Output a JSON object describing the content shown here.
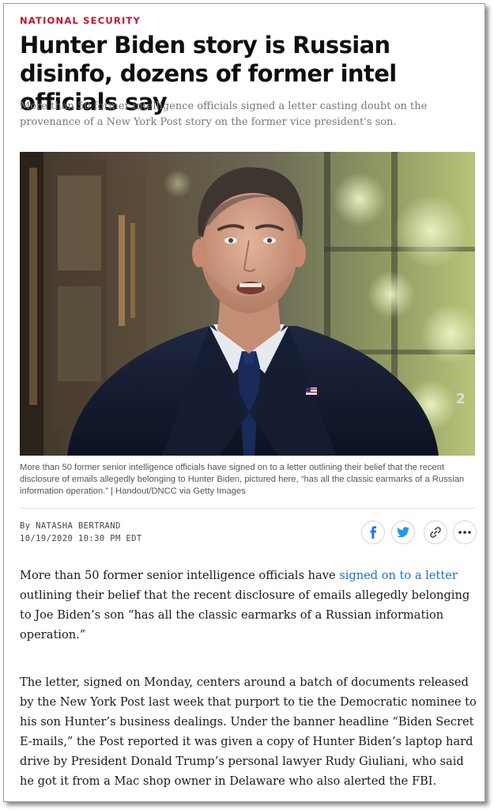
{
  "article": {
    "kicker": "NATIONAL SECURITY",
    "headline": "Hunter Biden story is Russian disinfo, dozens of former intel officials say",
    "dek": "More than 50 former intelligence officials signed a letter casting doubt on the provenance of a New York Post story on the former vice president's son.",
    "image": {
      "watermark": "2"
    },
    "caption": "More than 50 former senior intelligence officials have signed on to a letter outlining their belief that the recent disclosure of emails allegedly belonging to Hunter Biden, pictured here, “has all the classic earmarks of a Russian information operation.” | Handout/DNCC via Getty Images",
    "byline": {
      "prefix": "By ",
      "author": "NATASHA BERTRAND",
      "timestamp": "10/19/2020 10:30 PM EDT"
    },
    "share": {
      "icons": [
        "facebook-icon",
        "twitter-icon",
        "link-icon",
        "more-icon"
      ],
      "colors": {
        "facebook": "#1877f2",
        "twitter": "#1da1f2",
        "neutral": "#333333"
      }
    },
    "paragraph1": {
      "before": "More than 50 former senior intelligence officials have ",
      "link": "signed on to a letter",
      "after": " outlining their belief that the recent disclosure of emails allegedly belonging to Joe Biden’s son “has all the classic earmarks of a Russian information operation.”"
    },
    "paragraph2": "The letter, signed on Monday, centers around a batch of documents released by the New York Post last week that purport to tie the Democratic nominee to his son Hunter’s business dealings. Under the banner headline “Biden Secret E-mails,” the Post reported it was given a copy of Hunter Biden’s laptop hard drive by President Donald Trump’s personal lawyer Rudy Giuliani, who said he got it from a Mac shop owner in Delaware who also alerted the FBI."
  },
  "colors": {
    "kicker": "#c8102e",
    "link": "#1d73c8",
    "suit": "#141b2e"
  }
}
